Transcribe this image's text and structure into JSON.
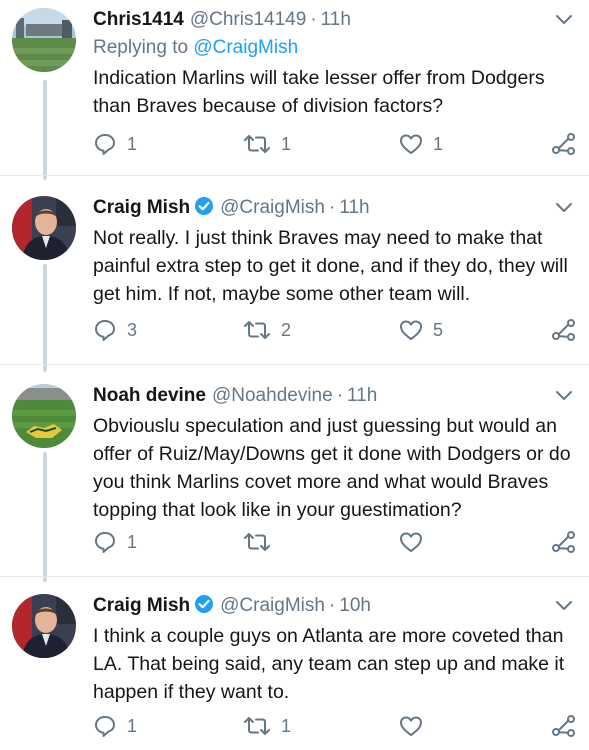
{
  "tweets": [
    {
      "display_name": "Chris1414",
      "handle": "@Chris14149",
      "dot": "·",
      "time": "11h",
      "verified": false,
      "reply_prefix": "Replying to ",
      "reply_to": "@CraigMish",
      "text": "Indication Marlins will take lesser offer from Dodgers than Braves because of division factors?",
      "replies": "1",
      "retweets": "1",
      "likes": "1"
    },
    {
      "display_name": "Craig Mish",
      "handle": "@CraigMish",
      "dot": "·",
      "time": "11h",
      "verified": true,
      "text": "Not really. I just think Braves may need to make that painful extra step to get it done, and if they do, they will get him. If not, maybe some other team will.",
      "replies": "3",
      "retweets": "2",
      "likes": "5"
    },
    {
      "display_name": "Noah devine",
      "handle": "@Noahdevine",
      "dot": "·",
      "time": "11h",
      "verified": false,
      "text": "Obviouslu speculation and just guessing but would an offer of Ruiz/May/Downs get it done with Dodgers or do you think Marlins covet more and what would Braves topping that look like in your guestimation?",
      "replies": "1",
      "retweets": "",
      "likes": ""
    },
    {
      "display_name": "Craig Mish",
      "handle": "@CraigMish",
      "dot": "·",
      "time": "10h",
      "verified": true,
      "text": "I think a couple guys on Atlanta are more coveted than LA. That being said, any team can step up and make it happen if they want to.",
      "replies": "1",
      "retweets": "1",
      "likes": ""
    }
  ],
  "icons": {
    "reply": "reply-icon",
    "retweet": "retweet-icon",
    "like": "heart-icon",
    "share": "share-icon",
    "caret": "chevron-down-icon",
    "verified": "verified-badge-icon"
  },
  "colors": {
    "text": "#14171a",
    "secondary": "#657786",
    "link": "#1da1f2",
    "thread_line": "#ccd6dd",
    "divider": "#e1e8ed"
  }
}
